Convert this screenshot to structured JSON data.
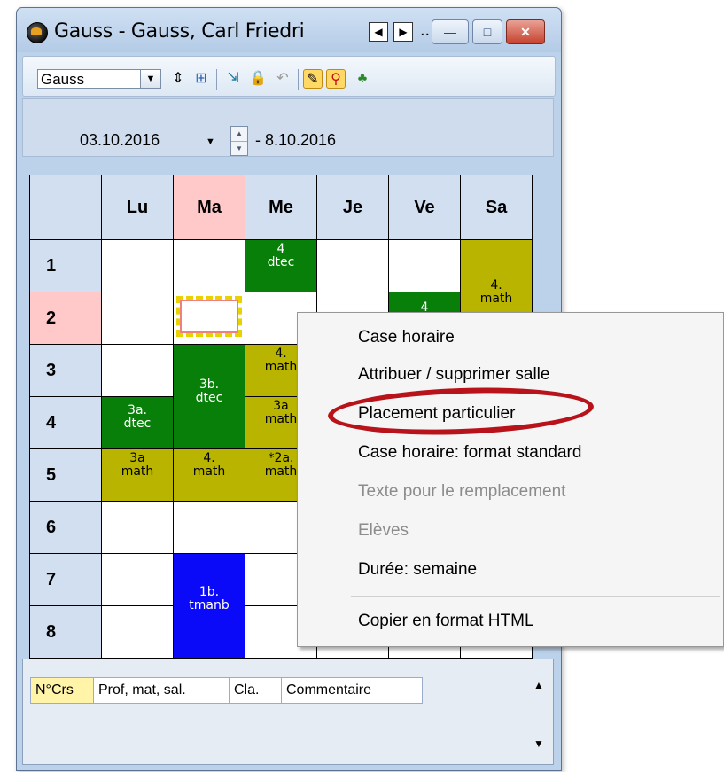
{
  "window": {
    "title": "Gauss - Gauss, Carl Friedri",
    "title_suffix": "..",
    "nav_prev": "◀",
    "nav_next": "▶",
    "minimize": "—",
    "maximize": "□",
    "close": "✕"
  },
  "toolbar": {
    "teacher_select": "Gauss",
    "icons": [
      "sort-icon",
      "grid-icon",
      "import-icon",
      "lock-icon",
      "undo-icon",
      "edit-icon",
      "search-icon",
      "people-icon"
    ]
  },
  "date_range": {
    "start": "03.10.2016",
    "end": "- 8.10.2016"
  },
  "timetable": {
    "days": [
      "Lu",
      "Ma",
      "Me",
      "Je",
      "Ve",
      "Sa"
    ],
    "periods": [
      "1",
      "2",
      "3",
      "4",
      "5",
      "6",
      "7",
      "8"
    ],
    "lessons": [
      {
        "day": "Me",
        "class": "4",
        "subject": "dtec",
        "color": "#087f08"
      },
      {
        "day": "Sa",
        "class": "4.",
        "subject": "math",
        "color": "#b8b400"
      },
      {
        "day": "Ve",
        "class": "4",
        "subject": "",
        "color": "#087f08"
      },
      {
        "day": "Ma",
        "class": "3b.",
        "subject": "dtec",
        "color": "#087f08"
      },
      {
        "day": "Me",
        "class": "4.",
        "subject": "math",
        "color": "#b8b400"
      },
      {
        "day": "Lu",
        "class": "3a.",
        "subject": "dtec",
        "color": "#087f08"
      },
      {
        "day": "Me",
        "class": "3a",
        "subject": "math",
        "color": "#b8b400"
      },
      {
        "day": "Lu",
        "class": "3a",
        "subject": "math",
        "color": "#b8b400"
      },
      {
        "day": "Ma",
        "class": "4.",
        "subject": "math",
        "color": "#b8b400"
      },
      {
        "day": "Me",
        "class": "*2a.",
        "subject": "math",
        "color": "#b8b400"
      },
      {
        "day": "Ma",
        "class": "1b.",
        "subject": "tmanb",
        "color": "#0a0af8"
      }
    ],
    "highlight_color": "#ffc9c9"
  },
  "bottom_panel": {
    "columns": [
      "N°Crs",
      "Prof, mat, sal.",
      "Cla.",
      "Commentaire"
    ]
  },
  "context_menu": {
    "items": [
      {
        "label": "Case horaire",
        "enabled": true
      },
      {
        "label": "Attribuer / supprimer salle",
        "enabled": true
      },
      {
        "label": "Placement particulier",
        "enabled": true
      },
      {
        "label": "Case horaire: format standard",
        "enabled": true
      },
      {
        "label": "Texte pour le remplacement",
        "enabled": false
      },
      {
        "label": "Elèves",
        "enabled": false
      },
      {
        "label": "Durée: semaine",
        "enabled": true
      },
      {
        "label": "Copier en format HTML",
        "enabled": true
      }
    ]
  },
  "annotation_color": "#b8121a"
}
